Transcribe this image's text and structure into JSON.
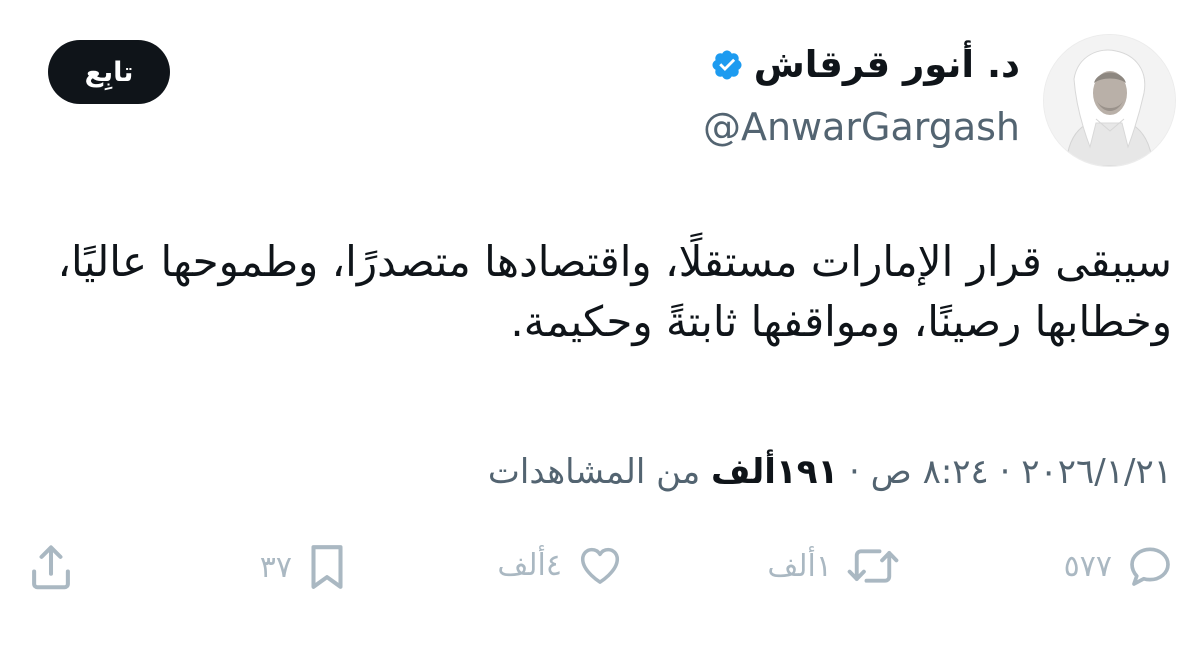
{
  "author": {
    "display_name": "د. أنور قرقاش",
    "handle": "@AnwarGargash",
    "verified_icon": "verified-badge-icon",
    "avatar_icon": "profile-photo"
  },
  "follow_button": {
    "label": "تابِع"
  },
  "tweet": {
    "text": "سيبقى قرار الإمارات مستقلًا، واقتصادها متصدرًا، وطموحها عاليًا، وخطابها رصينًا، ومواقفها ثابتةً وحكيمة."
  },
  "meta": {
    "time": "٨:٢٤ ص",
    "separator": "·",
    "date": "٢٠٢٦/١/٢١",
    "views_count": "١٩١ألف",
    "views_label": "من المشاهدات"
  },
  "actions": {
    "reply": {
      "count": "٥٧٧",
      "icon": "reply-icon"
    },
    "retweet": {
      "count": "١ألف",
      "icon": "retweet-icon"
    },
    "like": {
      "count": "٤ألف",
      "icon": "heart-icon"
    },
    "bookmark": {
      "count": "٣٧",
      "icon": "bookmark-icon"
    },
    "share": {
      "icon": "share-icon"
    }
  },
  "colors": {
    "text_primary": "#0f1419",
    "text_secondary": "#536471",
    "action_gray": "#aab8c2",
    "verified_blue": "#1d9bf0",
    "button_bg": "#0f1419"
  }
}
